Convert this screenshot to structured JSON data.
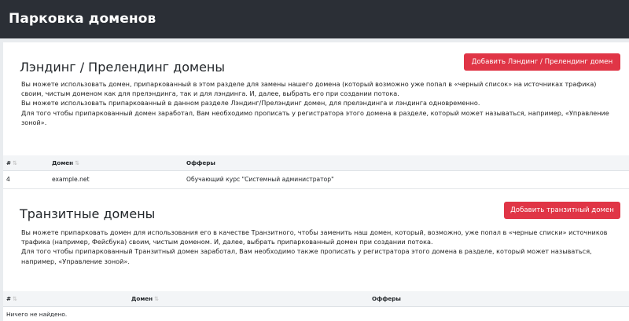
{
  "header": {
    "title": "Парковка доменов"
  },
  "landing": {
    "title": "Лэндинг / Прелендинг домены",
    "add_button": "Добавить Лэндинг / Прелендинг домен",
    "paragraphs": [
      "Вы можете использовать домен, припаркованный в этом разделе для замены нашего домена (который возможно уже попал в «черный список» на источниках трафика) своим, чистым доменом как для прелэндинга, так и для лэндинга. И, далее, выбрать его при создании потока.",
      "Вы можете использовать припаркованный в данном разделе Лэндинг/Прелэндинг домен, для прелэндинга и лэндинга одновременно.",
      "Для того чтобы припаркованный домен заработал, Вам необходимо прописать у регистратора этого домена в разделе, который может называться, например, «Управление зоной»."
    ],
    "table": {
      "columns": [
        "#",
        "Домен",
        "Офферы"
      ],
      "rows": [
        {
          "id": "4",
          "domain": "example.net",
          "offers": "Обучающий курс \"Системный администратор\""
        }
      ]
    }
  },
  "transit": {
    "title": "Транзитные домены",
    "add_button": "Добавить транзитный домен",
    "paragraphs": [
      "Вы можете припарковать домен для использования его в качестве Транзитного, чтобы заменить наш домен, который, возможно, уже попал в «черные списки» источников трафика (например, Фейсбука) своим, чистым доменом. И, далее, выбрать припаркованный домен при создании потока.",
      "Для того чтобы припаркованный Транзитный домен заработал, Вам необходимо также прописать у регистратора этого домена в разделе, который может называться, например, «Управление зоной»."
    ],
    "table": {
      "columns": [
        "#",
        "Домен",
        "Офферы"
      ],
      "empty_text": "Ничего не найдено."
    }
  },
  "colors": {
    "header_bg": "#2b2f36",
    "accent": "#e03546",
    "page_bg": "#e9ecef"
  },
  "icons": {
    "sort": "sort-arrows-icon"
  }
}
